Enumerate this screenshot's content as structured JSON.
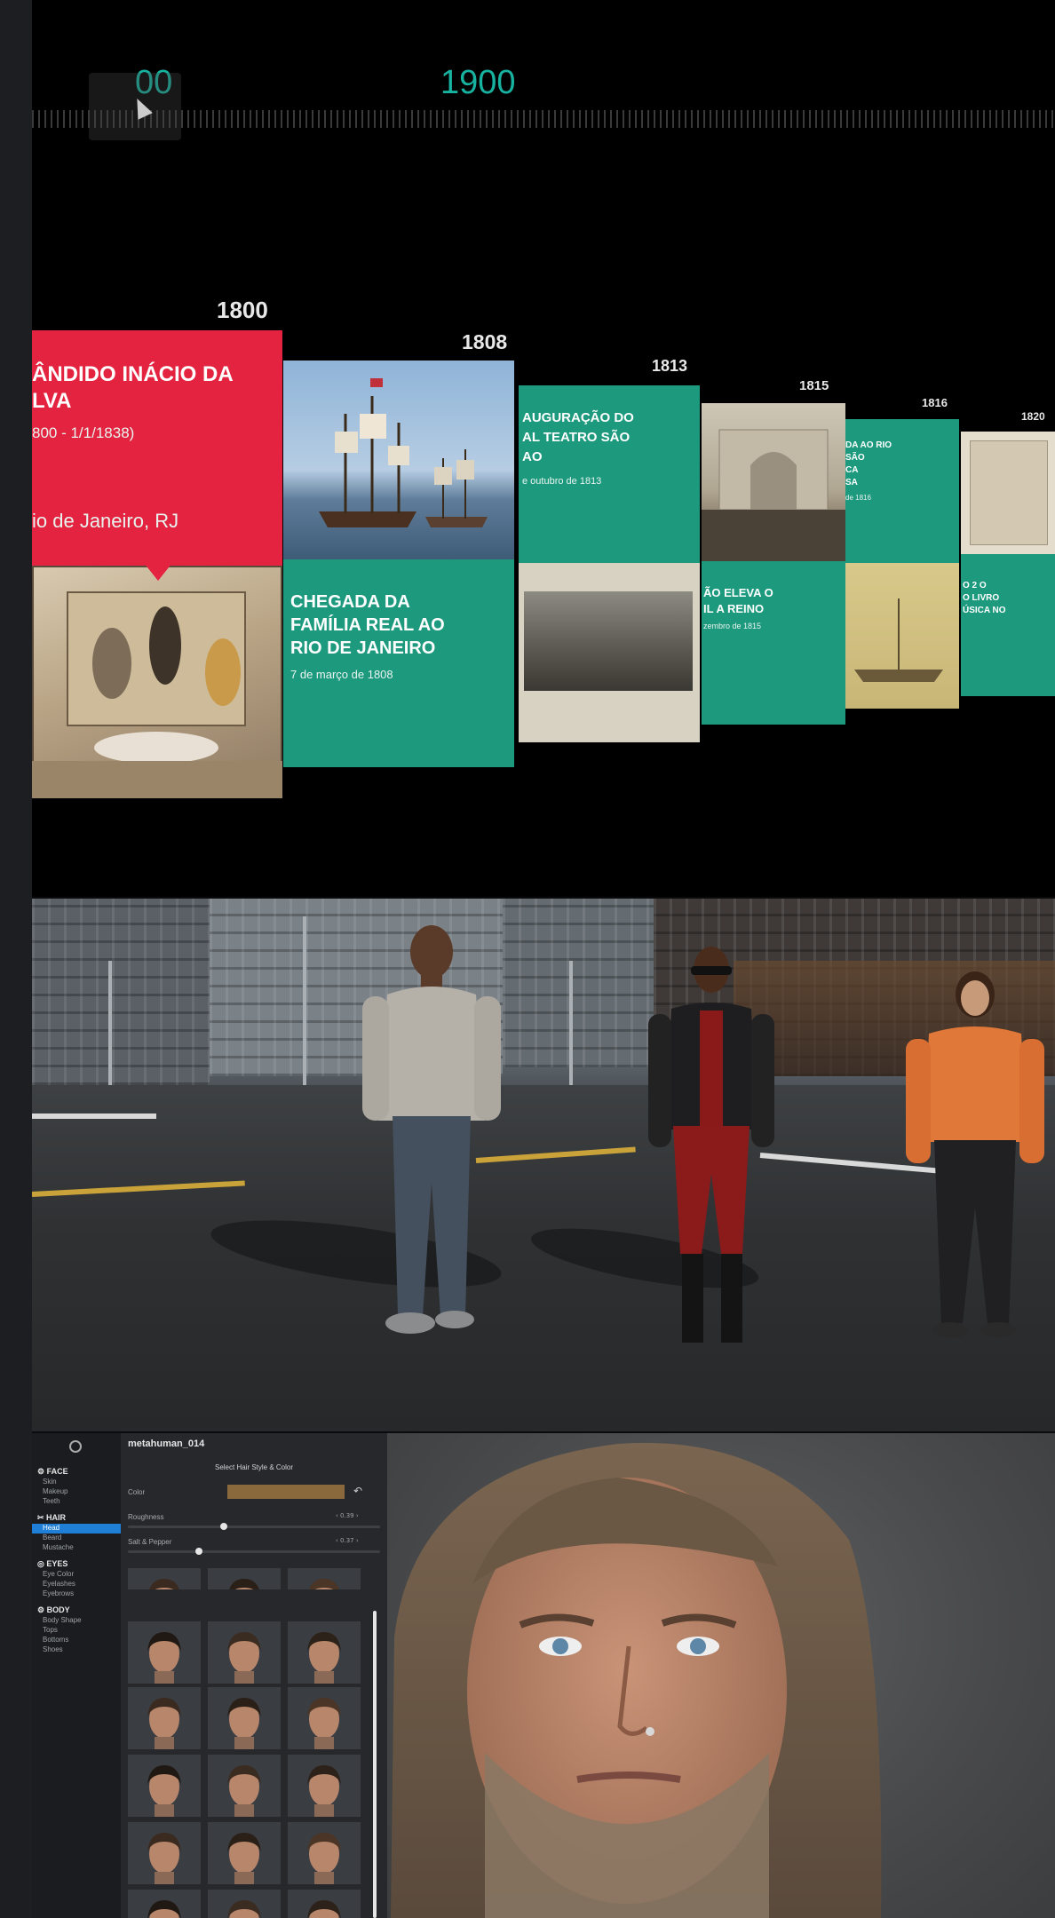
{
  "timeline": {
    "ruler_labels": [
      "00",
      "1900"
    ],
    "cards": [
      {
        "year": "1800",
        "title_lines": [
          "ÂNDIDO INÁCIO DA",
          "LVA"
        ],
        "dates": "800 - 1/1/1838)",
        "place": "io de Janeiro, RJ"
      },
      {
        "year": "1808",
        "title_lines": [
          "CHEGADA DA",
          "FAMÍLIA REAL AO",
          "RIO DE JANEIRO"
        ],
        "date": "7 de março de 1808"
      },
      {
        "year": "1813",
        "title_lines": [
          "AUGURAÇÃO DO",
          "AL TEATRO SÃO",
          "AO"
        ],
        "date": "e outubro de 1813"
      },
      {
        "year": "1815",
        "title_lines": [
          "ÃO ELEVA O",
          "IL A REINO"
        ],
        "date": "zembro de 1815"
      },
      {
        "year": "1816",
        "title_lines": [
          "DA AO RIO",
          "SÃO",
          "CA",
          "SA"
        ],
        "date": "de 1816"
      },
      {
        "year": "1820",
        "title_lines": [
          "O 2 O",
          "O LIVRO",
          "ÚSICA NO"
        ],
        "date": ""
      }
    ]
  },
  "street": {
    "characters": [
      {
        "name": "man-grey-sweater"
      },
      {
        "name": "woman-leather-jacket"
      },
      {
        "name": "woman-orange-top"
      }
    ]
  },
  "metahuman": {
    "title": "metahuman_014",
    "panel_heading": "Select Hair Style & Color",
    "nav": [
      {
        "head": "FACE",
        "items": [
          "Skin",
          "Makeup",
          "Teeth"
        ]
      },
      {
        "head": "HAIR",
        "items": [
          "Head",
          "Beard",
          "Mustache"
        ],
        "active": "Head"
      },
      {
        "head": "EYES",
        "items": [
          "Eye Color",
          "Eyelashes",
          "Eyebrows"
        ]
      },
      {
        "head": "BODY",
        "items": [
          "Body Shape",
          "Tops",
          "Bottoms",
          "Shoes"
        ]
      }
    ],
    "controls": {
      "color_label": "Color",
      "color_swatch": "#8a6a3c",
      "roughness_label": "Roughness",
      "roughness_value": "0.39",
      "salt_label": "Salt & Pepper",
      "salt_value": "0.37"
    }
  }
}
